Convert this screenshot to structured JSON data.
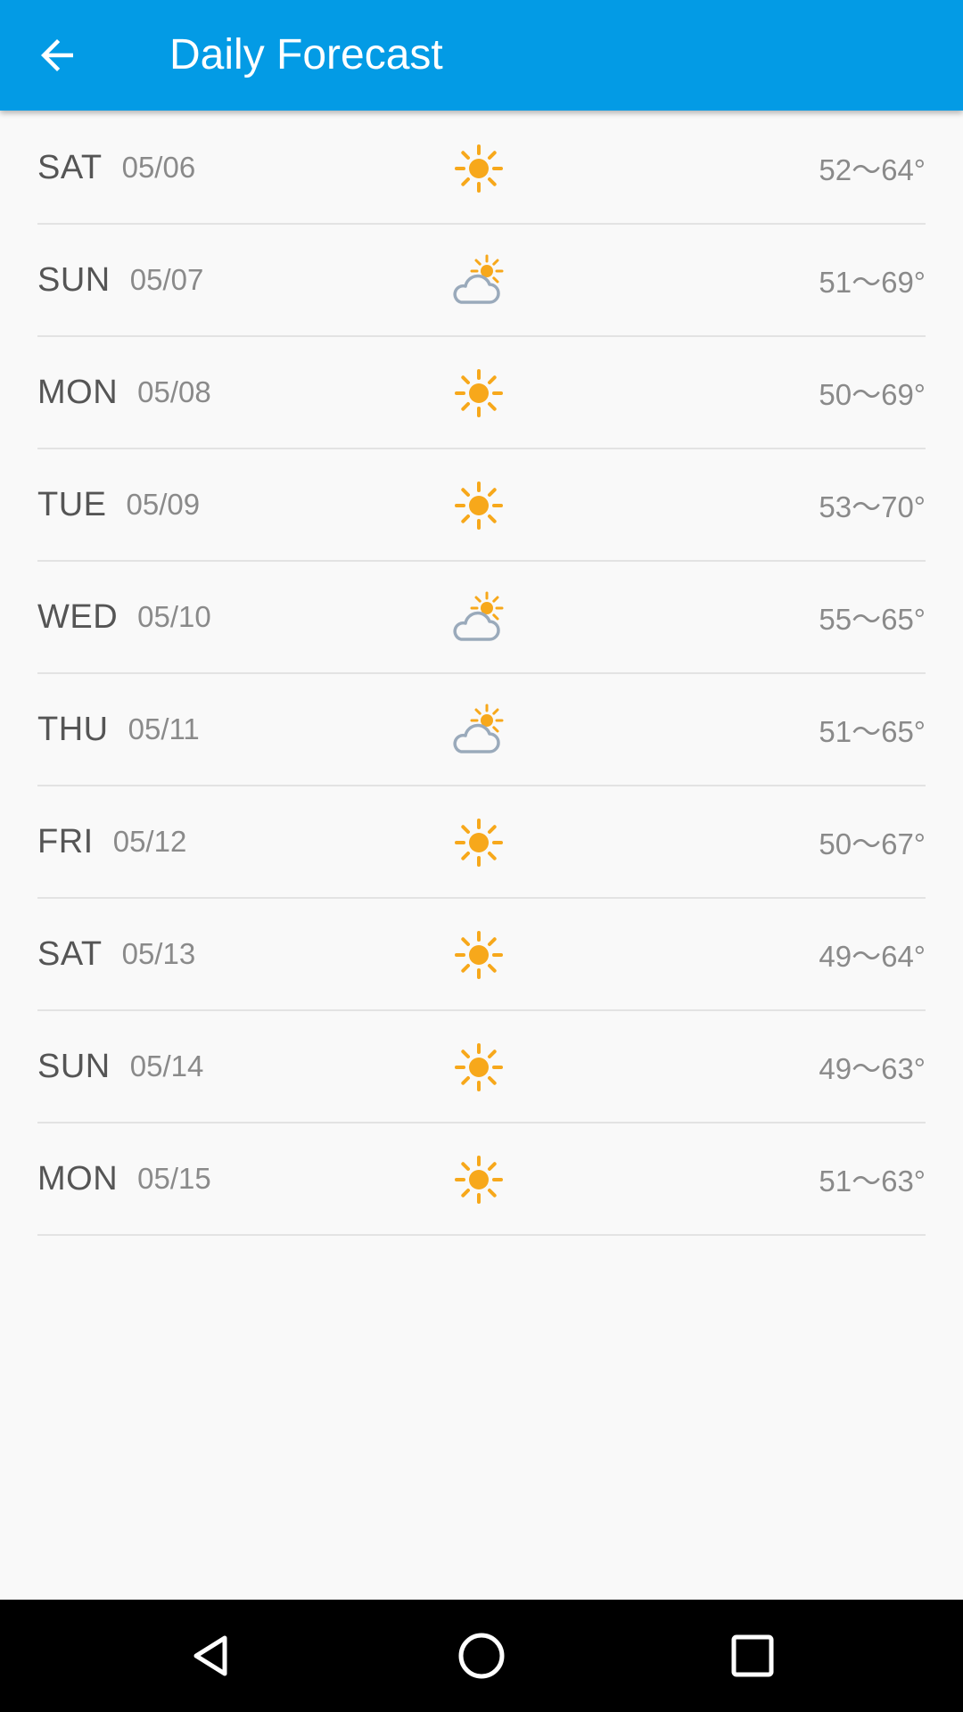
{
  "header": {
    "title": "Daily Forecast",
    "back_icon": "arrow-left-icon",
    "background_color": "#039be5"
  },
  "forecast": [
    {
      "day": "SAT",
      "date": "05/06",
      "condition": "sunny",
      "temp": "52～64°"
    },
    {
      "day": "SUN",
      "date": "05/07",
      "condition": "partly-cloudy",
      "temp": "51～69°"
    },
    {
      "day": "MON",
      "date": "05/08",
      "condition": "sunny",
      "temp": "50～69°"
    },
    {
      "day": "TUE",
      "date": "05/09",
      "condition": "sunny",
      "temp": "53～70°"
    },
    {
      "day": "WED",
      "date": "05/10",
      "condition": "partly-cloudy",
      "temp": "55～65°"
    },
    {
      "day": "THU",
      "date": "05/11",
      "condition": "partly-cloudy",
      "temp": "51～65°"
    },
    {
      "day": "FRI",
      "date": "05/12",
      "condition": "sunny",
      "temp": "50～67°"
    },
    {
      "day": "SAT",
      "date": "05/13",
      "condition": "sunny",
      "temp": "49～64°"
    },
    {
      "day": "SUN",
      "date": "05/14",
      "condition": "sunny",
      "temp": "49～63°"
    },
    {
      "day": "MON",
      "date": "05/15",
      "condition": "sunny",
      "temp": "51～63°"
    }
  ],
  "colors": {
    "sun": "#f7a81b",
    "cloud": "#9aaabb"
  },
  "system_nav": {
    "back_icon": "triangle-back-icon",
    "home_icon": "circle-home-icon",
    "recents_icon": "square-recents-icon"
  }
}
